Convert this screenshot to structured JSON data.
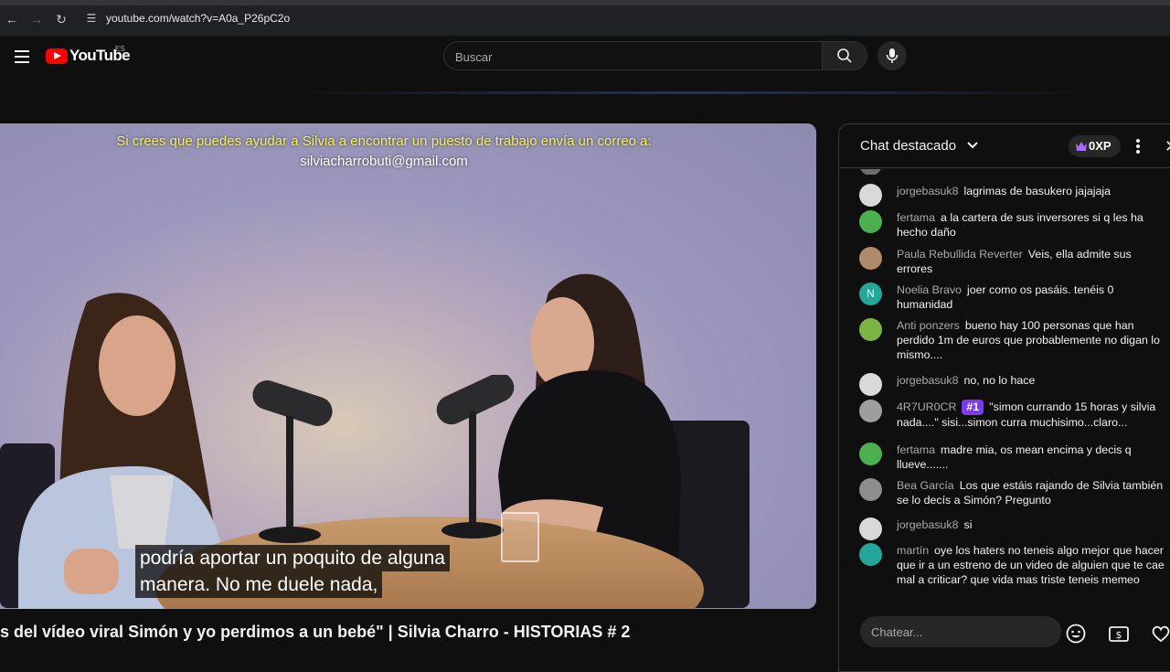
{
  "browser": {
    "url": "youtube.com/watch?v=A0a_P26pC2o"
  },
  "header": {
    "logo_text": "YouTube",
    "region": "ES",
    "search_placeholder": "Buscar"
  },
  "player": {
    "caption_top": "Si crees que puedes ayudar a Silvia a encontrar un puesto de trabajo envía un correo a:",
    "caption_email": "silviacharrobuti@gmail.com",
    "subtitle_line1": "podría aportar un poquito de alguna",
    "subtitle_line2": "manera. No me duele nada,"
  },
  "video": {
    "title_visible": "s del vídeo viral Simón y yo perdimos a un bebé\" | Silvia Charro - HISTORIAS # 2"
  },
  "chat": {
    "title": "Chat destacado",
    "xp": "0XP",
    "input_placeholder": "Chatear...",
    "messages": [
      {
        "author": "jorgebasuk8",
        "text": "lagrimas de basukero jajajaja",
        "avatar": "#d9d9d9"
      },
      {
        "author": "fertama",
        "text": "a la cartera de sus inversores si q les ha hecho daño",
        "avatar": "#4caf50"
      },
      {
        "author": "Paula Rebullida Reverter",
        "text": "Veis, ella admite sus errores",
        "avatar": "#b08a6a"
      },
      {
        "author": "Noelia Bravo",
        "text": "joer como os pasáis. tenéis 0 humanidad",
        "avatar": "#26a69a",
        "initial": "N"
      },
      {
        "author": "Anti ponzers",
        "text": "bueno hay 100 personas que han perdido 1m de euros que probablemente no digan lo mismo....",
        "avatar": "#7cb342"
      },
      {
        "author": "jorgebasuk8",
        "text": "no, no lo hace",
        "avatar": "#d9d9d9"
      },
      {
        "author": "4R7UR0CR",
        "badge": "#1",
        "text": "\"simon currando 15 horas y silvia nada....\" sisi...simon curra muchisimo...claro...",
        "avatar": "#9e9e9e"
      },
      {
        "author": "fertama",
        "text": "madre mia, os mean encima y decis q llueve.......",
        "avatar": "#4caf50"
      },
      {
        "author": "Bea García",
        "text": "Los que estáis rajando de Silvia también se lo decís a Simón? Pregunto",
        "avatar": "#8d8d8d"
      },
      {
        "author": "jorgebasuk8",
        "text": "si",
        "avatar": "#d9d9d9"
      },
      {
        "author": "martín",
        "text": "oye los haters no teneis algo mejor que hacer que ir a un estreno de un video de alguien que te cae mal a criticar? que vida mas triste teneis memeo",
        "avatar": "#26a69a"
      }
    ]
  }
}
